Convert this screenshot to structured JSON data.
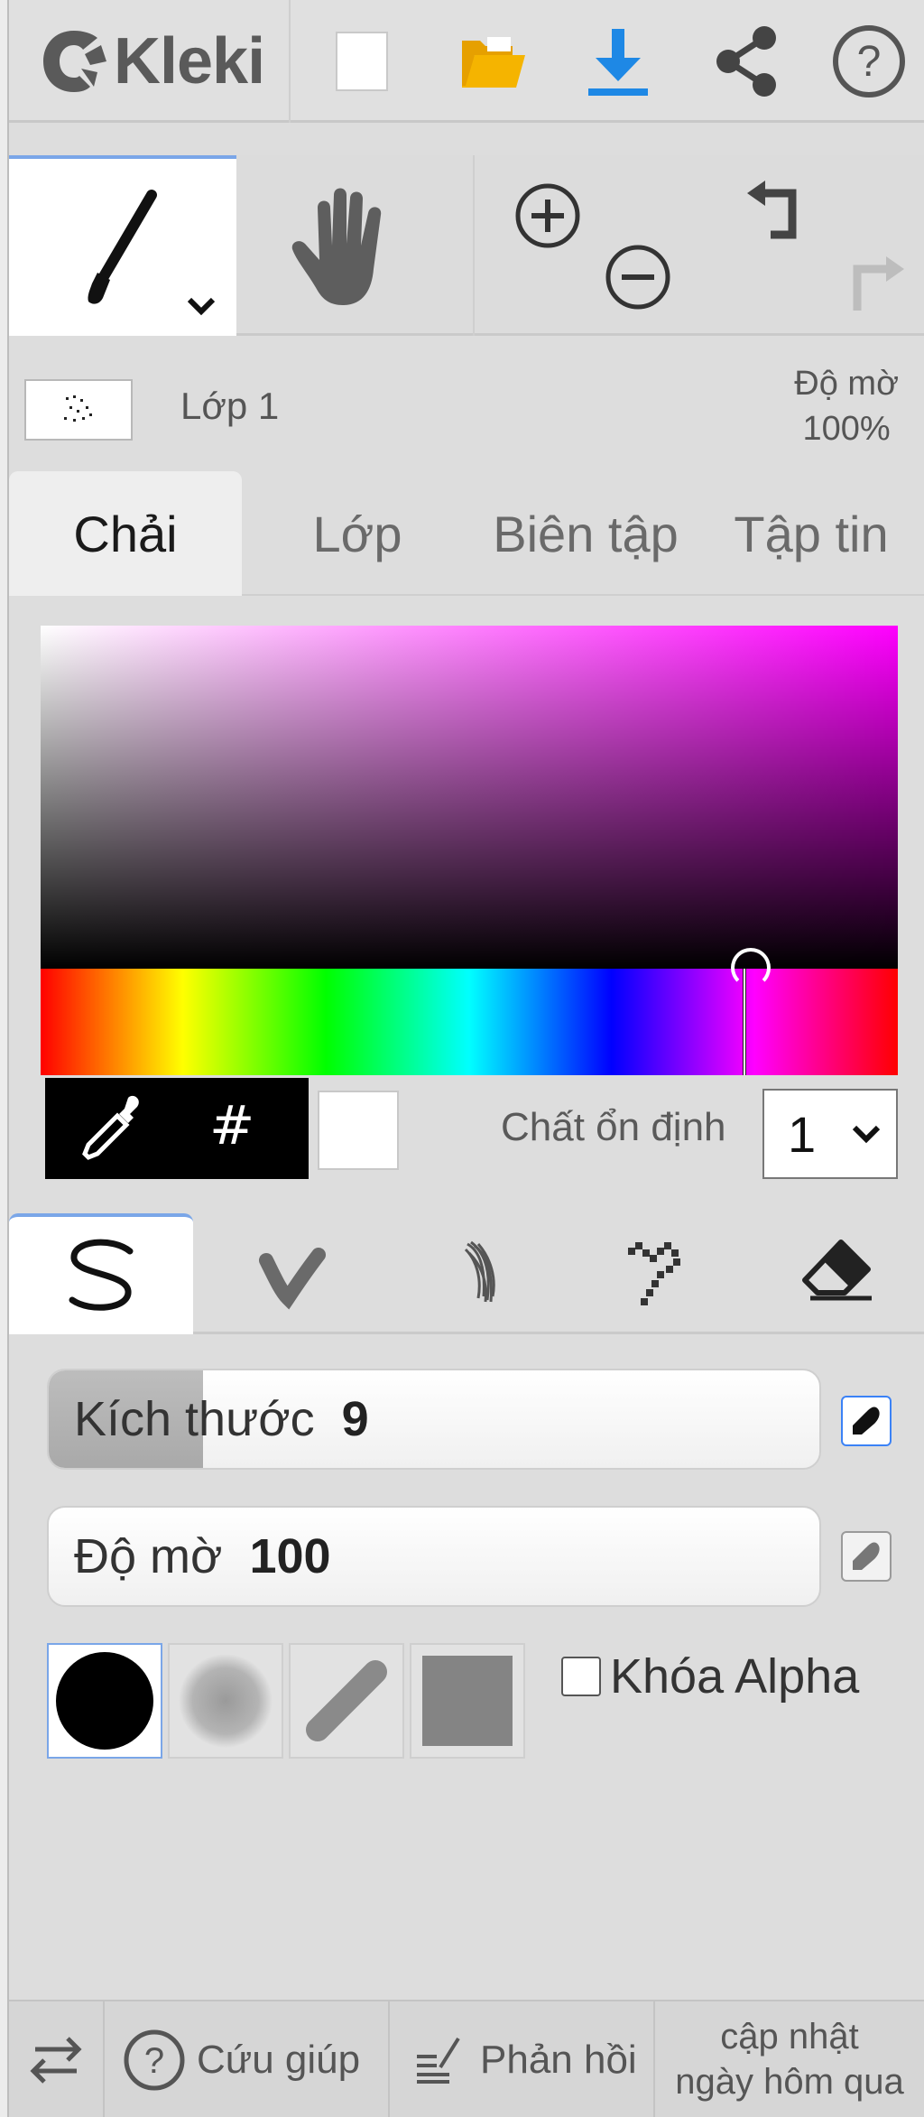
{
  "app": {
    "logo_text": "Kleki"
  },
  "toolbar": {
    "buttons": [
      "new-image",
      "open-file",
      "download",
      "share",
      "help"
    ],
    "accent_color": "#1e88e5",
    "folder_color": "#f5b400"
  },
  "tools": {
    "active": "brush",
    "items": [
      "brush",
      "hand",
      "zoom",
      "undo-redo"
    ]
  },
  "layer": {
    "name": "Lớp 1",
    "opacity_label": "Độ mờ",
    "opacity_value": "100%"
  },
  "tabs": [
    {
      "label": "Chải",
      "active": true
    },
    {
      "label": "Lớp",
      "active": false
    },
    {
      "label": "Biên tập",
      "active": false
    },
    {
      "label": "Tập tin",
      "active": false
    }
  ],
  "color": {
    "hue_color": "#ff00ff",
    "selected": "#ffffff",
    "hex_label": "#",
    "stabilizer_label": "Chất ổn định",
    "stabilizer_value": "1"
  },
  "brush_types": {
    "active": "pen",
    "items": [
      "pen",
      "blend",
      "sketchy",
      "pixel",
      "eraser"
    ]
  },
  "sliders": {
    "size": {
      "label": "Kích thước",
      "value": "9",
      "fill": 0.2
    },
    "opacity": {
      "label": "Độ mờ",
      "value": "100",
      "fill": 0.0
    }
  },
  "shapes": {
    "active": "round-hard",
    "items": [
      "round-hard",
      "round-soft",
      "chalk",
      "square"
    ]
  },
  "alpha_lock": {
    "label": "Khóa Alpha",
    "checked": false
  },
  "bottom": {
    "help": "Cứu giúp",
    "feedback": "Phản hồi",
    "update_line1": "cập nhật",
    "update_line2": "ngày hôm qua"
  }
}
